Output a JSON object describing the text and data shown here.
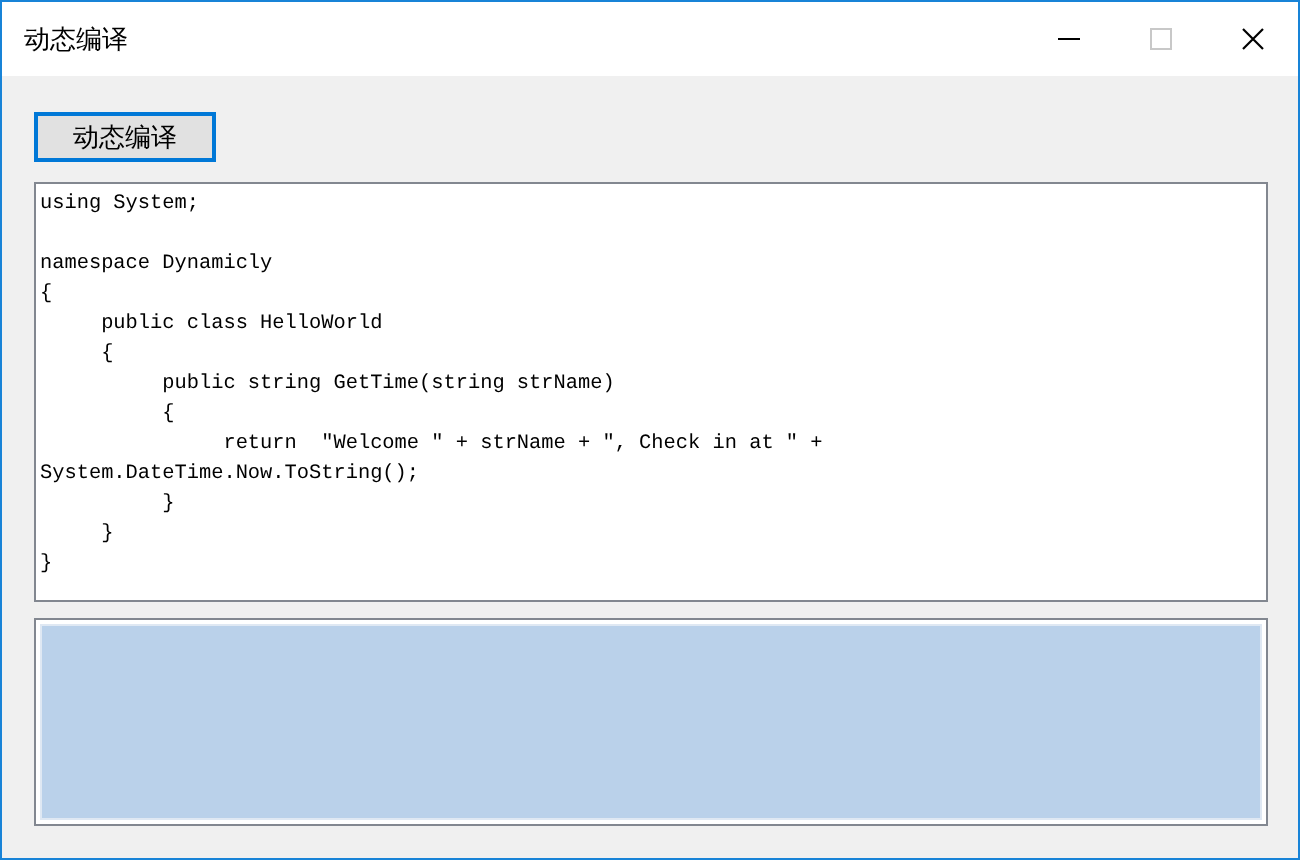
{
  "window": {
    "title": "动态编译",
    "controls": [
      {
        "kind": "minimize",
        "disabled": false
      },
      {
        "kind": "maximize",
        "disabled": true
      },
      {
        "kind": "close",
        "disabled": false
      }
    ]
  },
  "compile_button": {
    "label": "动态编译",
    "focused": true
  },
  "code_editor": {
    "value": "using System;\n\nnamespace Dynamicly\n{\n     public class HelloWorld\n     {\n          public string GetTime(string strName)\n          {\n               return  \"Welcome \" + strName + \", Check in at \" +\nSystem.DateTime.Now.ToString();\n          }\n     }\n}"
  },
  "output_box": {
    "selected": true
  }
}
